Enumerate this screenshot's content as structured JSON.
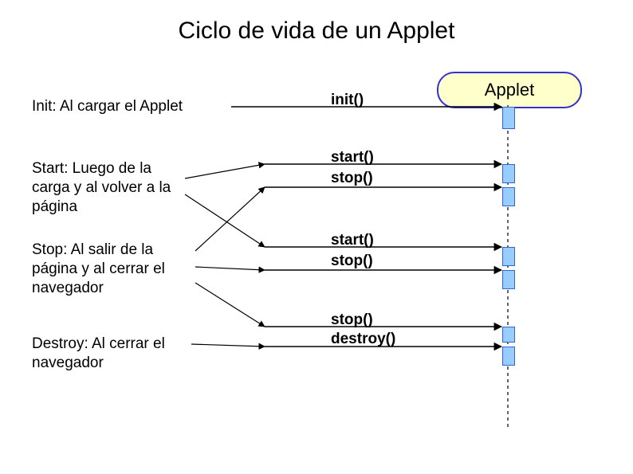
{
  "title": "Ciclo de vida de un Applet",
  "object_label": "Applet",
  "descriptions": {
    "init": "Init: Al cargar el Applet",
    "start": "Start: Luego de la carga y al volver a la página",
    "stop": "Stop: Al salir de la página y al cerrar el navegador",
    "destroy": "Destroy: Al cerrar el navegador"
  },
  "messages": {
    "init": "init()",
    "start1": "start()",
    "stop1": "stop()",
    "start2": "start()",
    "stop2": "stop()",
    "stop3": "stop()",
    "destroy": "destroy()"
  },
  "colors": {
    "applet_border": "#3333cc",
    "applet_fill": "#ffffcc",
    "activation_fill": "#99ccff",
    "activation_border": "#3366cc"
  }
}
